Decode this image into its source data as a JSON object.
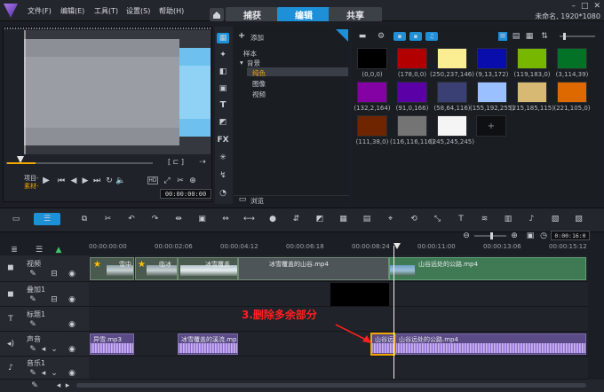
{
  "menu": [
    "文件(F)",
    "编辑(E)",
    "工具(T)",
    "设置(S)",
    "帮助(H)"
  ],
  "tabs": [
    {
      "label": "捕获",
      "active": false
    },
    {
      "label": "编辑",
      "active": true
    },
    {
      "label": "共享",
      "active": false
    }
  ],
  "project_info": "未命名, 1920*1080",
  "player": {
    "project_label": "项目-",
    "clip_label": "素材-",
    "timecode": "00:00:00:00",
    "hd_badge": "HD"
  },
  "library": {
    "add_label": "添加",
    "tree": [
      "样本",
      "背景",
      "纯色",
      "图像",
      "视频"
    ],
    "selected": "纯色",
    "browse_label": "浏览"
  },
  "swatches": [
    {
      "label": "(0,0,0)",
      "color": "#000000"
    },
    {
      "label": "(178,0,0)",
      "color": "#b20000"
    },
    {
      "label": "(250,237,146)",
      "color": "#faed92"
    },
    {
      "label": "(9,13,172)",
      "color": "#090dac"
    },
    {
      "label": "(119,183,0)",
      "color": "#77b700"
    },
    {
      "label": "(3,114,39)",
      "color": "#037227"
    },
    {
      "label": "(132,2,164)",
      "color": "#8402a4"
    },
    {
      "label": "(91,0,166)",
      "color": "#5b00a6"
    },
    {
      "label": "(58,64,116)",
      "color": "#3a4074"
    },
    {
      "label": "(155,192,255)",
      "color": "#9bc0ff"
    },
    {
      "label": "(215,185,115)",
      "color": "#d7b973"
    },
    {
      "label": "(221,105,0)",
      "color": "#dd6900"
    },
    {
      "label": "(111,38,0)",
      "color": "#6f2600"
    },
    {
      "label": "(116,116,116)",
      "color": "#747474"
    },
    {
      "label": "(245,245,245)",
      "color": "#f5f5f5"
    }
  ],
  "timeline": {
    "zoom_timecode": "0:00:16:0",
    "ruler": [
      "00:00:00:00",
      "00:00:02:06",
      "00:00:04:12",
      "00:00:06:18",
      "00:00:08:24",
      "00:00:11:00",
      "00:00:13:06",
      "00:00:15:12"
    ],
    "tracks": [
      {
        "name": "视频"
      },
      {
        "name": "叠加1"
      },
      {
        "name": "标题1"
      },
      {
        "name": "声音"
      },
      {
        "name": "音乐1"
      }
    ],
    "video_clips": [
      "雪中",
      "冰雪覆盖",
      "冰雪覆盖的山谷.mp4",
      "山谷远处的公路.mp4"
    ],
    "video_clip_partial": "临冰",
    "audio_clips": [
      "异雪.mp3",
      "冰雪覆盖的溪流.mp",
      "山谷远",
      "山谷远处的公路.mp4"
    ],
    "annotation": "3.删除多余部分"
  }
}
